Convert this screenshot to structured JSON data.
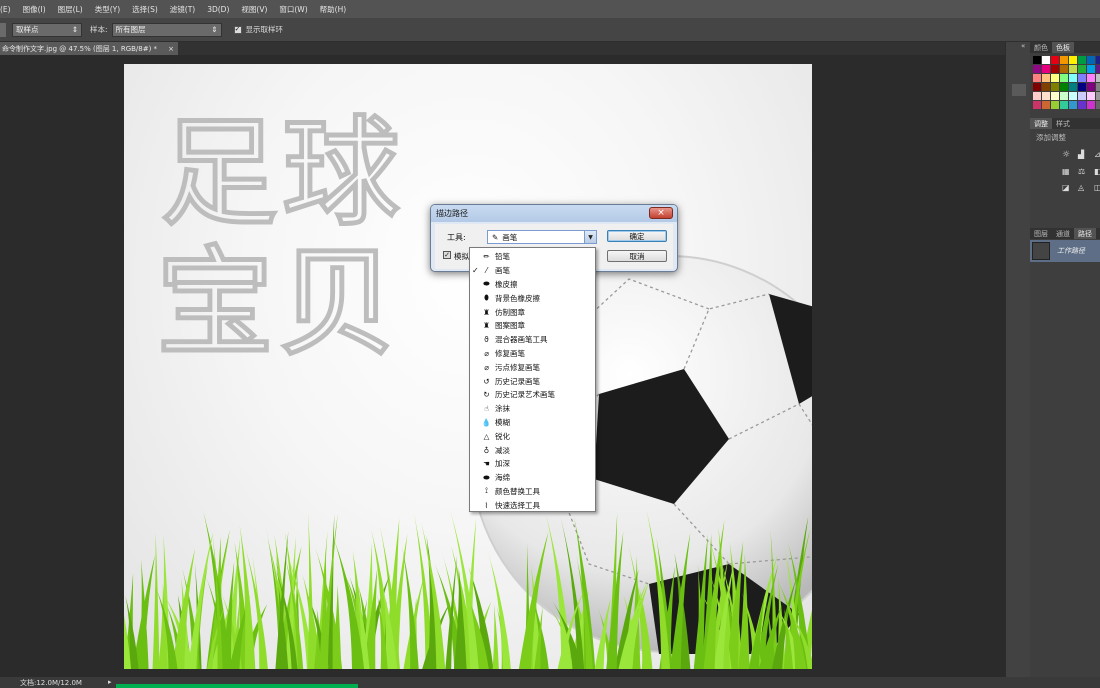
{
  "menu": [
    "(E)",
    "图像(I)",
    "图层(L)",
    "类型(Y)",
    "选择(S)",
    "滤镜(T)",
    "3D(D)",
    "视图(V)",
    "窗口(W)",
    "帮助(H)"
  ],
  "options": {
    "sample_point_value": "取样点",
    "sample_label": "样本:",
    "sample_value": "所有图层",
    "show_ring_label": "显示取样环"
  },
  "document": {
    "tab_title": "命令制作文字.jpg @ 47.5% (图层 1, RGB/8#) *",
    "tab_close": "×"
  },
  "canvas_text": {
    "line1": "足球",
    "line2": "宝贝"
  },
  "status": {
    "doc_size": "文档:12.0M/12.0M"
  },
  "panels": {
    "color_tabs": [
      "颜色",
      "色板"
    ],
    "adjust_tabs": [
      "调整",
      "样式"
    ],
    "add_adjust": "添加调整",
    "layer_tabs": [
      "图层",
      "通道",
      "路径"
    ],
    "work_path": "工作路径"
  },
  "dialog": {
    "title": "描边路径",
    "tool_label": "工具:",
    "tool_value": "画笔",
    "ok": "确定",
    "cancel": "取消",
    "simulate_label": "模拟"
  },
  "dropdown": {
    "checked_index": 1,
    "items": [
      "铅笔",
      "画笔",
      "橡皮擦",
      "背景色橡皮擦",
      "仿制图章",
      "图案图章",
      "混合器画笔工具",
      "修复画笔",
      "污点修复画笔",
      "历史记录画笔",
      "历史记录艺术画笔",
      "涂抹",
      "模糊",
      "锐化",
      "减淡",
      "加深",
      "海绵",
      "颜色替换工具",
      "快速选择工具"
    ],
    "icons": [
      "pencil-icon",
      "brush-icon",
      "eraser-icon",
      "background-eraser-icon",
      "clone-stamp-icon",
      "pattern-stamp-icon",
      "mixer-brush-icon",
      "healing-brush-icon",
      "spot-healing-icon",
      "history-brush-icon",
      "art-history-brush-icon",
      "smudge-icon",
      "blur-icon",
      "sharpen-icon",
      "dodge-icon",
      "burn-icon",
      "sponge-icon",
      "color-replace-icon",
      "quick-select-icon"
    ]
  },
  "colors": {
    "menubar": "#535353",
    "grass": "#7ccc1a",
    "ball_black": "#1c1c1c",
    "progress": "#00b050"
  }
}
